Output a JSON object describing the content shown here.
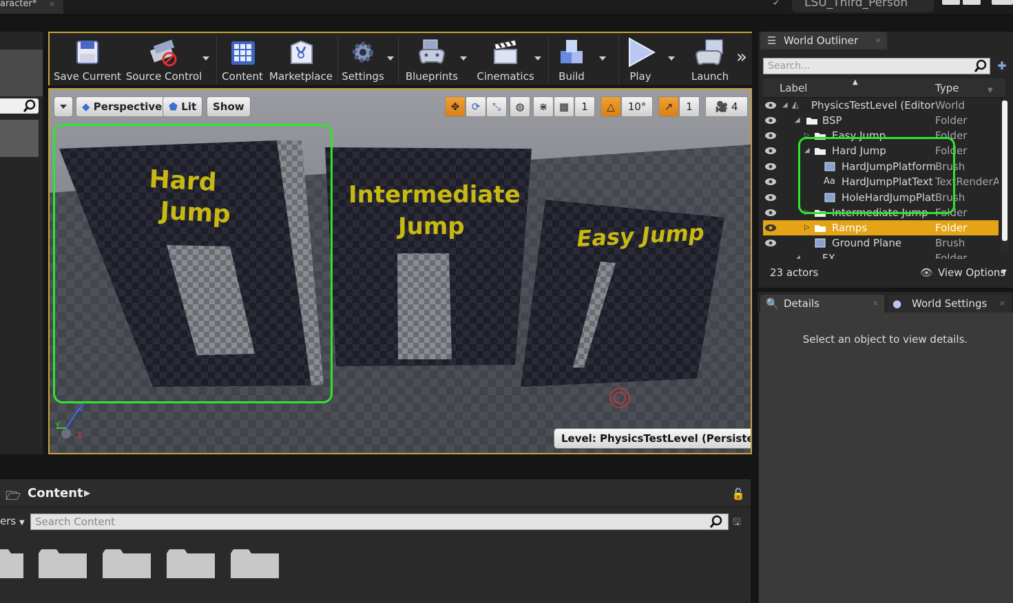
{
  "window": {
    "document_tab": "aracter*",
    "document_tab_close": "×",
    "project_name": "LSU_Third_Person"
  },
  "toolbar": {
    "items": [
      {
        "label": "Save Current",
        "icon": "save-icon"
      },
      {
        "label": "Source Control",
        "icon": "source-control-icon"
      },
      {
        "label": "Content",
        "icon": "content-icon"
      },
      {
        "label": "Marketplace",
        "icon": "marketplace-icon"
      },
      {
        "label": "Settings",
        "icon": "settings-icon"
      },
      {
        "label": "Blueprints",
        "icon": "blueprints-icon"
      },
      {
        "label": "Cinematics",
        "icon": "cinematics-icon"
      },
      {
        "label": "Build",
        "icon": "build-icon"
      },
      {
        "label": "Play",
        "icon": "play-icon"
      },
      {
        "label": "Launch",
        "icon": "launch-icon"
      }
    ],
    "overflow": "»"
  },
  "viewport": {
    "perspective_label": "Perspective",
    "lit_label": "Lit",
    "show_label": "Show",
    "grid_snap": "1",
    "rotation_snap": "10°",
    "scale_snap": "1",
    "camera_speed": "4",
    "level_label": "Level:  PhysicsTestLevel (Persistent)",
    "scene_texts": {
      "hard_jump_line1": "Hard",
      "hard_jump_line2": "Jump",
      "intermediate_line1": "Intermediate",
      "intermediate_line2": "Jump",
      "easy": "Easy Jump"
    },
    "axis_labels": {
      "z": "Z",
      "y": "Y",
      "x": "X"
    }
  },
  "world_outliner": {
    "tab_label": "World Outliner",
    "tab_close": "×",
    "search_placeholder": "Search...",
    "col_label": "Label",
    "col_type": "Type",
    "rows": [
      {
        "name": "PhysicsTestLevel (Editor)",
        "type": "World"
      },
      {
        "name": "BSP",
        "type": "Folder"
      },
      {
        "name": "Easy Jump",
        "type": "Folder"
      },
      {
        "name": "Hard Jump",
        "type": "Folder"
      },
      {
        "name": "HardJumpPlatform",
        "type": "Brush"
      },
      {
        "name": "HardJumpPlatText",
        "type": "TextRenderActor"
      },
      {
        "name": "HoleHardJumpPlatform",
        "type": "Brush"
      },
      {
        "name": "Intermediate Jump",
        "type": "Folder"
      },
      {
        "name": "Ramps",
        "type": "Folder"
      },
      {
        "name": "Ground Plane",
        "type": "Brush"
      },
      {
        "name": "FX",
        "type": "Folder"
      }
    ],
    "actor_count": "23 actors",
    "view_options": "View Options"
  },
  "details": {
    "tab_label": "Details",
    "tab_close": "×",
    "world_settings_label": "World Settings",
    "world_settings_close": "×",
    "empty_message": "Select an object to view details."
  },
  "content_browser": {
    "title": "Content",
    "filters_label": "ers",
    "search_placeholder": "Search Content"
  },
  "colors": {
    "accent_orange": "#e5a418",
    "highlight_green": "#2ee62e",
    "scene_text_yellow": "#c8b814"
  }
}
